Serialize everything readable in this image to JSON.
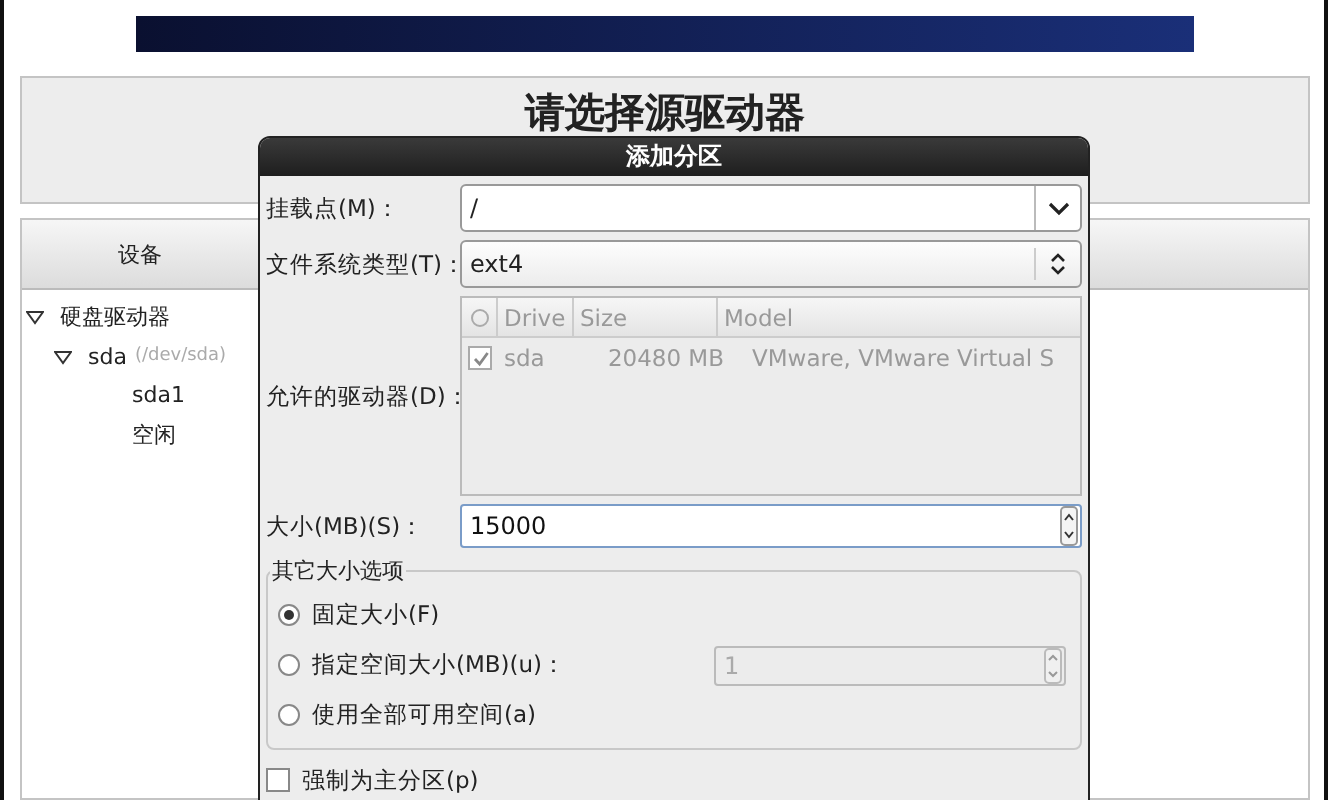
{
  "page": {
    "heading": "请选择源驱动器"
  },
  "device_table": {
    "columns": [
      "设备"
    ],
    "tree": [
      {
        "label": "硬盘驱动器",
        "expanded": true,
        "children": [
          {
            "label": "sda",
            "note": "(/dev/sda)",
            "expanded": true,
            "children": [
              {
                "label": "sda1"
              },
              {
                "label": "空闲"
              }
            ]
          }
        ]
      }
    ]
  },
  "dialog": {
    "title": "添加分区",
    "mount_point": {
      "label": "挂载点(M)：",
      "value": "/"
    },
    "fs_type": {
      "label": "文件系统类型(T)：",
      "value": "ext4"
    },
    "drives": {
      "label": "允许的驱动器(D)：",
      "disabled": true,
      "columns": [
        "Drive",
        "Size",
        "Model"
      ],
      "rows": [
        {
          "checked": true,
          "drive": "sda",
          "size": "20480 MB",
          "model": "VMware, VMware Virtual S"
        }
      ]
    },
    "size": {
      "label": "大小(MB)(S)：",
      "value": "15000"
    },
    "size_options": {
      "title": "其它大小选项",
      "options": [
        {
          "label": "固定大小(F)",
          "selected": true
        },
        {
          "label": "指定空间大小(MB)(u)：",
          "selected": false,
          "spin": {
            "value": "1",
            "disabled": true
          }
        },
        {
          "label": "使用全部可用空间(a)",
          "selected": false
        }
      ]
    },
    "primary": {
      "label": "强制为主分区(p)",
      "checked": false
    }
  }
}
